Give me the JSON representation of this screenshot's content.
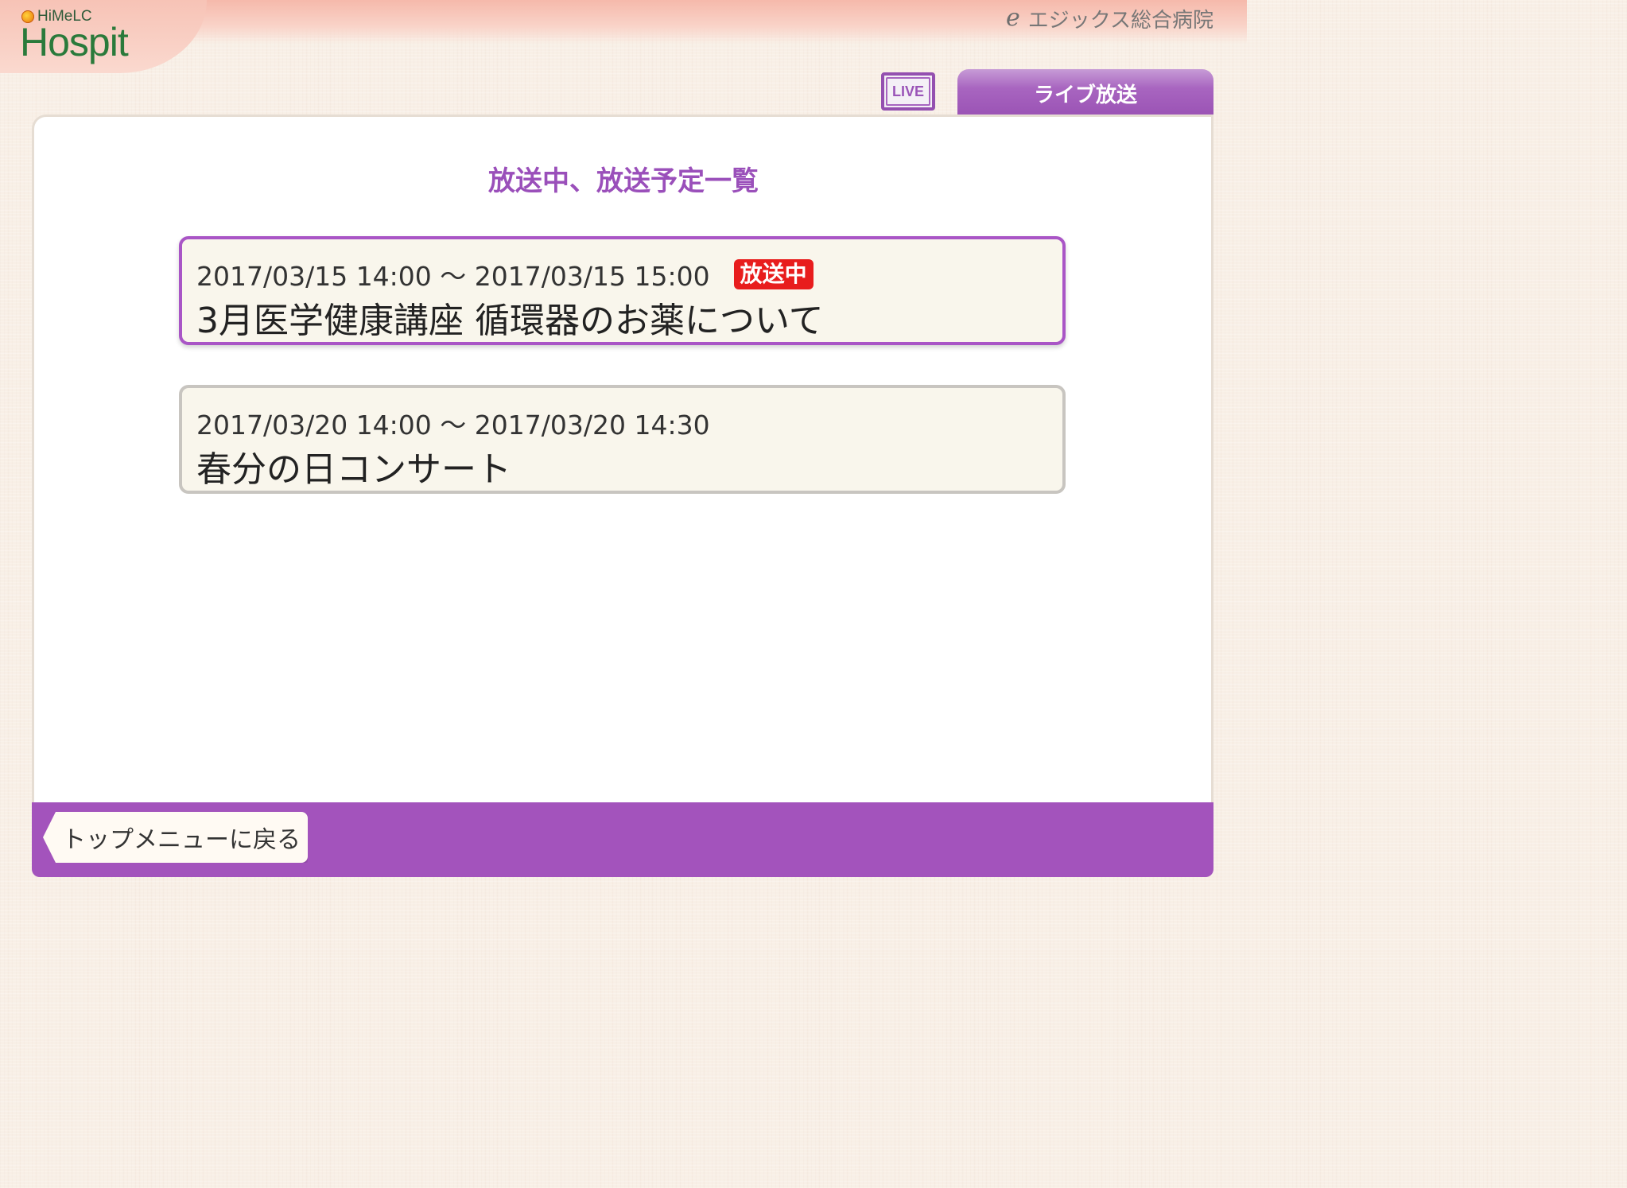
{
  "header": {
    "logo_small_text": "HiMeLC",
    "logo_big_text": "Hospit",
    "hospital_mark": "e",
    "hospital_name": "エジックス総合病院"
  },
  "nav": {
    "live_icon_text": "LIVE",
    "live_tab_label": "ライブ放送"
  },
  "main": {
    "title": "放送中、放送予定一覧",
    "broadcasts": [
      {
        "time": "2017/03/15 14:00 〜 2017/03/15 15:00",
        "badge": "放送中",
        "title": "3月医学健康講座 循環器のお薬について"
      },
      {
        "time": "2017/03/20 14:00 〜 2017/03/20 14:30",
        "title": "春分の日コンサート"
      }
    ]
  },
  "footer": {
    "back_label": "トップメニューに戻る"
  },
  "colors": {
    "accent_purple": "#a353bc",
    "on_air_red": "#e81d1d",
    "logo_green": "#2a7a3b"
  }
}
